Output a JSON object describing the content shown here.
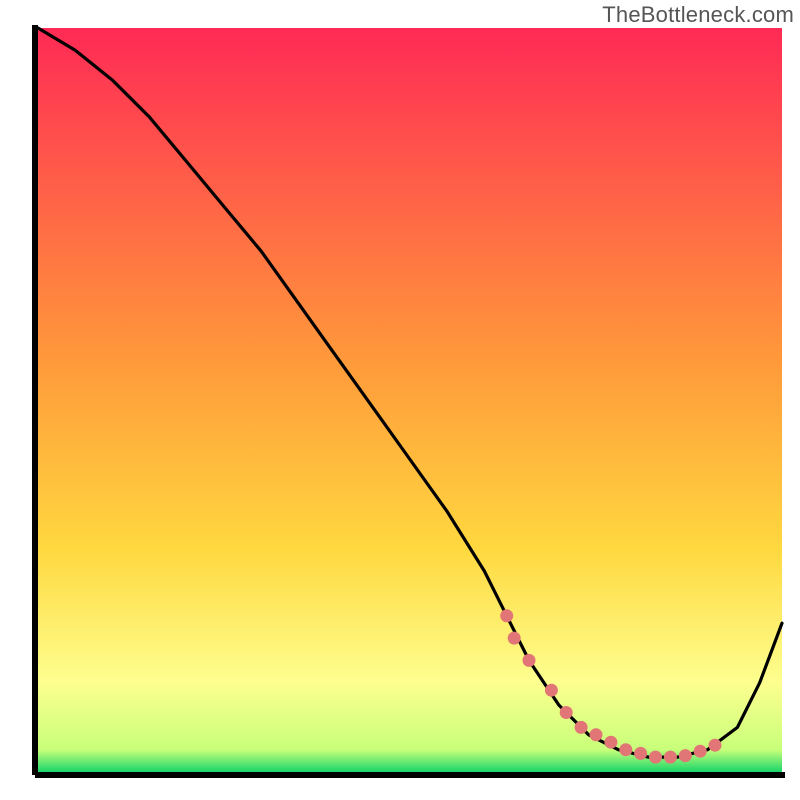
{
  "watermark": "TheBottleneck.com",
  "colors": {
    "axis": "#000000",
    "curve": "#000000",
    "dot": "#e27575",
    "gradient_top": "#ff2a55",
    "gradient_mid": "#ffd83f",
    "gradient_low": "#fdff8f",
    "gradient_bottom": "#18d66b"
  },
  "chart_data": {
    "type": "line",
    "title": "",
    "xlabel": "",
    "ylabel": "",
    "xlim": [
      0,
      100
    ],
    "ylim": [
      0,
      100
    ],
    "grid": false,
    "legend": false,
    "series": [
      {
        "name": "bottleneck-curve",
        "x": [
          0,
          5,
          10,
          15,
          20,
          25,
          30,
          35,
          40,
          45,
          50,
          55,
          60,
          63,
          66,
          70,
          74,
          78,
          82,
          86,
          90,
          94,
          97,
          100
        ],
        "y": [
          100,
          97,
          93,
          88,
          82,
          76,
          70,
          63,
          56,
          49,
          42,
          35,
          27,
          21,
          15,
          9,
          5,
          3,
          2,
          2,
          3,
          6,
          12,
          20
        ]
      }
    ],
    "highlight_points": {
      "name": "flat-region-dots",
      "x": [
        63,
        64,
        66,
        69,
        71,
        73,
        75,
        77,
        79,
        81,
        83,
        85,
        87,
        89,
        91
      ],
      "y": [
        21,
        18,
        15,
        11,
        8,
        6,
        5,
        4,
        3,
        2.5,
        2,
        2,
        2.2,
        2.8,
        3.6
      ]
    }
  }
}
